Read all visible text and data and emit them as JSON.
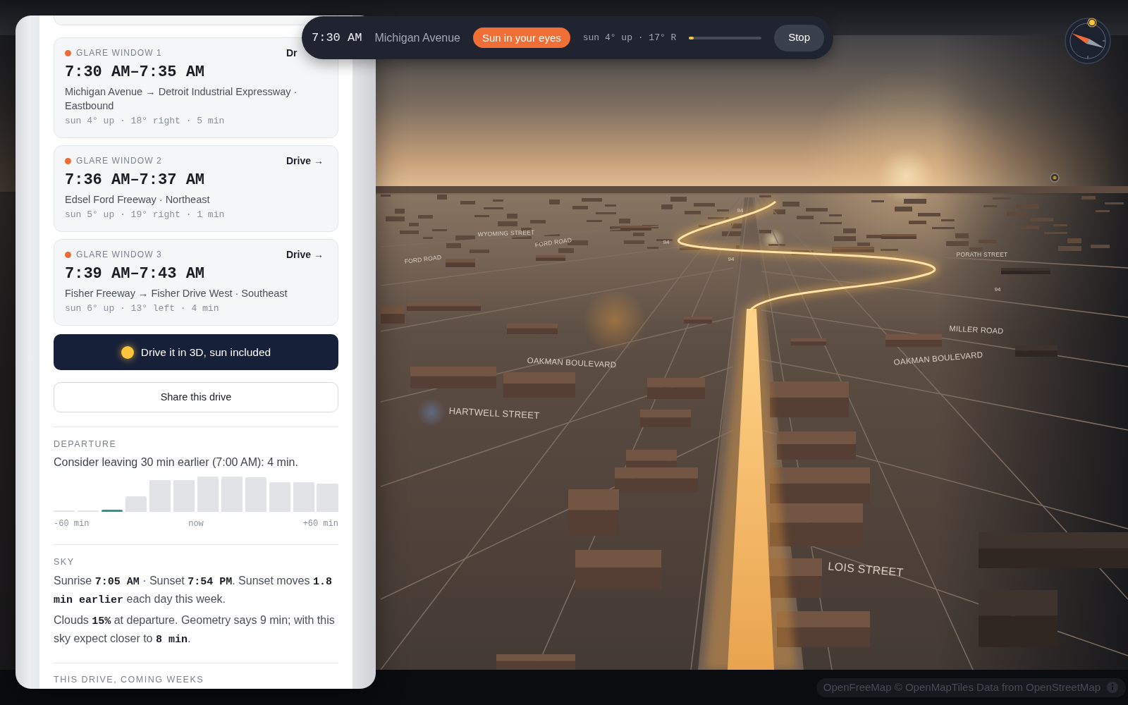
{
  "glare_windows": [
    {
      "label": "GLARE WINDOW 1",
      "action": "Dr",
      "time": "7:30 AM–7:35 AM",
      "route": "Michigan Avenue → Detroit Industrial Expressway · Eastbound",
      "detail": "sun 4° up · 18° right · 5 min"
    },
    {
      "label": "GLARE WINDOW 2",
      "action": "Drive →",
      "time": "7:36 AM–7:37 AM",
      "route": "Edsel Ford Freeway · Northeast",
      "detail": "sun 5° up · 19° right · 1 min"
    },
    {
      "label": "GLARE WINDOW 3",
      "action": "Drive →",
      "time": "7:39 AM–7:43 AM",
      "route": "Fisher Freeway → Fisher Drive West · Southeast",
      "detail": "sun 6° up · 13° left · 4 min"
    }
  ],
  "drive_3d_button": "Drive it in 3D, sun included",
  "share_button": "Share this drive",
  "departure": {
    "heading": "DEPARTURE",
    "text": "Consider leaving 30 min earlier (7:00 AM): 4 min.",
    "bars": [
      {
        "selected": false
      },
      {
        "selected": false
      },
      {
        "selected": true
      },
      {
        "selected": false
      },
      {
        "selected": false
      },
      {
        "selected": false
      },
      {
        "selected": false
      },
      {
        "selected": false
      },
      {
        "selected": false
      },
      {
        "selected": false
      },
      {
        "selected": false
      },
      {
        "selected": false
      }
    ],
    "axis_labels": [
      "-60 min",
      "now",
      "+60 min"
    ]
  },
  "sky": {
    "heading": "SKY",
    "paragraphs": [
      "Sunrise **7:05 AM** · Sunset **7:54 PM**. Sunset moves **1.8 min earlier** each day this week.",
      "Clouds **15%** at departure. Geometry says 9 min; with this sky expect closer to **8 min**."
    ]
  },
  "coming_weeks": {
    "heading": "THIS DRIVE, COMING WEEKS"
  },
  "drive_bar": {
    "time": "7:30 AM",
    "street": "Michigan Avenue",
    "alert": "Sun in your eyes",
    "sun_reading": "sun 4° up · 17° R",
    "progress": {
      "level": 0.06
    },
    "stop_button": "Stop"
  },
  "map": {
    "labels": [
      "WYOMING STREET",
      "FORD ROAD",
      "FORD ROAD",
      "94",
      "94",
      "94",
      "PORATH STREET",
      "94",
      "MILLER ROAD",
      "OAKMAN BOULEVARD",
      "OAKMAN BOULEVARD",
      "HARTWELL STREET",
      "LOIS STREET"
    ],
    "attribution": "OpenFreeMap © OpenMapTiles Data from OpenStreetMap"
  }
}
